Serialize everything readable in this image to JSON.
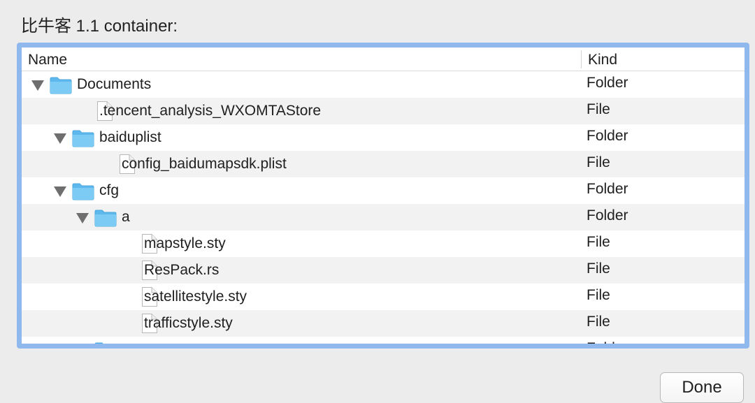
{
  "dialog": {
    "title": "比牛客 1.1 container:",
    "done_label": "Done"
  },
  "columns": {
    "name": "Name",
    "kind": "Kind"
  },
  "rows": [
    {
      "name": "Documents",
      "kind": "Folder",
      "type": "folder",
      "level": 0,
      "expanded": true
    },
    {
      "name": ".tencent_analysis_WXOMTAStore",
      "kind": "File",
      "type": "file",
      "level": 1
    },
    {
      "name": "baiduplist",
      "kind": "Folder",
      "type": "folder",
      "level": 1,
      "expanded": true
    },
    {
      "name": "config_baidumapsdk.plist",
      "kind": "File",
      "type": "file",
      "level": 2
    },
    {
      "name": "cfg",
      "kind": "Folder",
      "type": "folder",
      "level": 1,
      "expanded": true
    },
    {
      "name": "a",
      "kind": "Folder",
      "type": "folder",
      "level": 2,
      "expanded": true
    },
    {
      "name": "mapstyle.sty",
      "kind": "File",
      "type": "file",
      "level": 3
    },
    {
      "name": "ResPack.rs",
      "kind": "File",
      "type": "file",
      "level": 3
    },
    {
      "name": "satellitestyle.sty",
      "kind": "File",
      "type": "file",
      "level": 3
    },
    {
      "name": "trafficstyle.sty",
      "kind": "File",
      "type": "file",
      "level": 3
    },
    {
      "name": "",
      "kind": "Folder",
      "type": "folder",
      "level": 2,
      "expanded": false,
      "partial": true
    }
  ],
  "icons": {
    "folder": "folder-icon",
    "file": "file-icon",
    "disclosure": "disclosure-triangle-icon"
  },
  "colors": {
    "focus_ring": "#8fb9ee",
    "folder": "#6fc3f2",
    "alt_row": "#f2f2f2"
  }
}
